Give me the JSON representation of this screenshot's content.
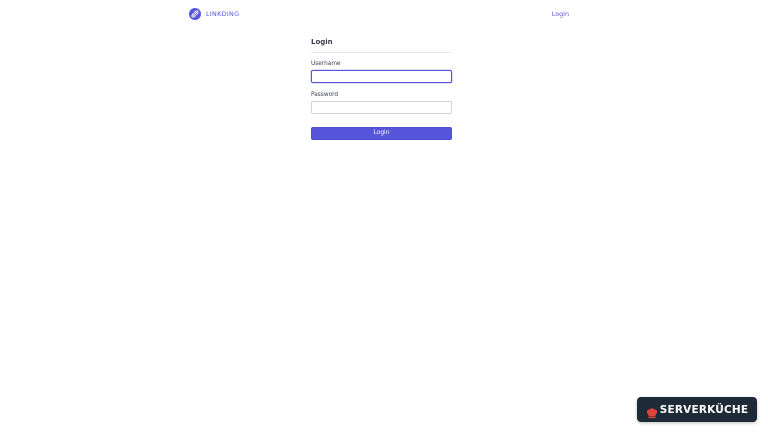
{
  "header": {
    "brand": "LINKDING",
    "login_link": "Login"
  },
  "login_form": {
    "title": "Login",
    "username_label": "Username",
    "username_value": "",
    "password_label": "Password",
    "password_value": "",
    "submit_label": "Login"
  },
  "watermark": {
    "text": "SERVERKÜCHE"
  },
  "colors": {
    "accent": "#5755d9",
    "text": "#3b3e52",
    "badge_bg": "#1f2a37",
    "badge_icon": "#e0453a"
  },
  "icons": {
    "brand_logo": "linkding-logo-icon",
    "badge_logo": "chef-hat-icon"
  }
}
